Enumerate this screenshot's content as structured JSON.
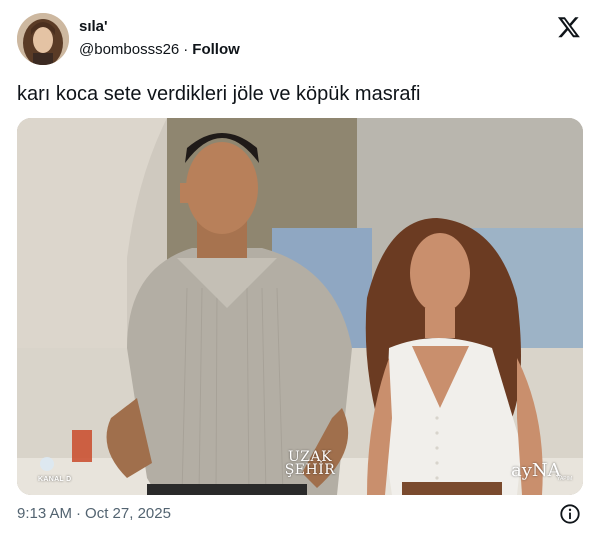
{
  "tweet": {
    "author": {
      "display_name": "sıla'",
      "handle": "@bombosss26",
      "follow_label": "Follow",
      "separator": "·"
    },
    "brand_icon": "x-logo-icon",
    "text": "karı koca sete verdikleri jöle ve köpük masrafi",
    "media": {
      "watermarks": {
        "channel": "KANAL D",
        "show_line1": "UZAK",
        "show_line2": "ŞEHİR",
        "producer": "ayNA",
        "producer_sub": "YAPIM"
      }
    },
    "timestamp": {
      "time": "9:13 AM",
      "separator": "·",
      "date": "Oct 27, 2025"
    },
    "info_icon": "info-icon"
  },
  "colors": {
    "text_primary": "#0f1419",
    "text_secondary": "#536471",
    "background": "#ffffff"
  }
}
